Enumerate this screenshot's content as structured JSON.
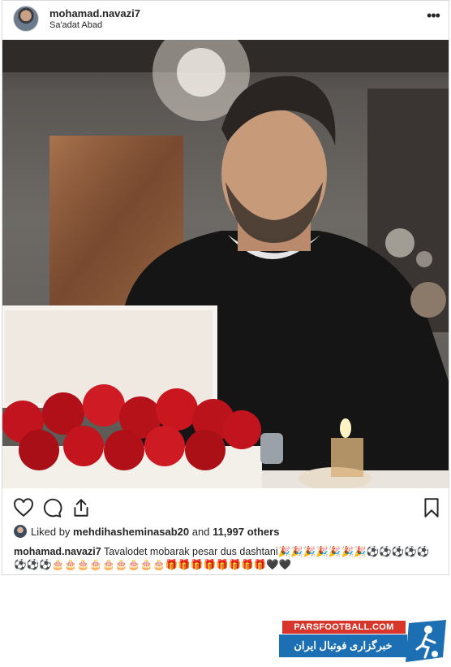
{
  "post": {
    "username": "mohamad.navazi7",
    "location": "Sa'adat Abad",
    "more_label": "•••",
    "likes": {
      "prefix": "Liked by",
      "user": "mehdihasheminasab20",
      "middle": "and",
      "count": "11,997 others"
    },
    "caption": {
      "user": "mohamad.navazi7",
      "text": "Tavalodet mobarak pesar dus dashtani🎉🎉🎉🎉🎉🎉🎉⚽⚽⚽⚽⚽⚽⚽⚽🎂🎂🎂🎂🎂🎂🎂🎂🎂🎁🎁🎁🎁🎁🎁🎁🎁🖤🖤"
    }
  },
  "watermark": {
    "site": "PARSFOOTBALL.COM",
    "tagline": "خبرگزاری فوتبال ایران"
  },
  "colors": {
    "brand_red": "#d9362b",
    "brand_blue": "#1d6fb3",
    "text": "#262626",
    "border": "#dbdbdb"
  }
}
